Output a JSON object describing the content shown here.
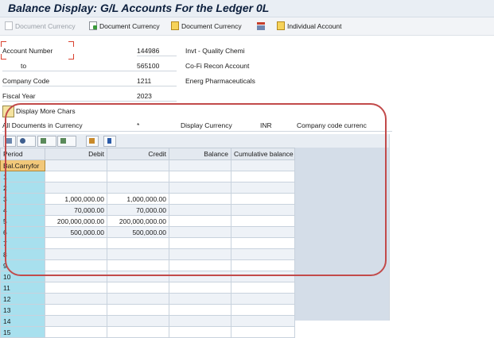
{
  "window": {
    "title": "Balance Display: G/L Accounts For the Ledger 0L"
  },
  "toolbar": {
    "buttons": [
      {
        "label": "Document Currency",
        "icon": "doc-gray-icon",
        "enabled": false
      },
      {
        "label": "Document Currency",
        "icon": "doc-green-icon",
        "enabled": true
      },
      {
        "label": "Document Currency",
        "icon": "doc-yellow-icon",
        "enabled": true
      },
      {
        "label": "",
        "icon": "grid-icon",
        "enabled": true
      },
      {
        "label": "Individual Account",
        "icon": "doc-yellow-icon",
        "enabled": true
      }
    ]
  },
  "header": {
    "account_number": {
      "label": "Account Number",
      "value": "144986",
      "desc": "Invt - Quality Chemi"
    },
    "to": {
      "label": "to",
      "value": "565100",
      "desc": "Co-Fi Recon Account"
    },
    "company_code": {
      "label": "Company Code",
      "value": "1211",
      "desc": "Energ Pharmaceuticals"
    },
    "fiscal_year": {
      "label": "Fiscal Year",
      "value": "2023"
    }
  },
  "more_chars": {
    "label": "Display More Chars"
  },
  "filter": {
    "all_docs_label": "All Documents in Currency",
    "all_docs_value": "*",
    "display_currency_label": "Display Currency",
    "display_currency_value": "INR",
    "company_code_currency": "Company code currenc"
  },
  "grid": {
    "columns": [
      "Period",
      "Debit",
      "Credit",
      "Balance",
      "Cumulative balance"
    ],
    "rows": [
      {
        "period": "Bal.Carryfor",
        "debit": "",
        "credit": "",
        "balance": "",
        "cumulative": ""
      },
      {
        "period": "1",
        "debit": "",
        "credit": "",
        "balance": "",
        "cumulative": ""
      },
      {
        "period": "2",
        "debit": "",
        "credit": "",
        "balance": "",
        "cumulative": ""
      },
      {
        "period": "3",
        "debit": "1,000,000.00",
        "credit": "1,000,000.00",
        "balance": "",
        "cumulative": ""
      },
      {
        "period": "4",
        "debit": "70,000.00",
        "credit": "70,000.00",
        "balance": "",
        "cumulative": ""
      },
      {
        "period": "5",
        "debit": "200,000,000.00",
        "credit": "200,000,000.00",
        "balance": "",
        "cumulative": ""
      },
      {
        "period": "6",
        "debit": "500,000.00",
        "credit": "500,000.00",
        "balance": "",
        "cumulative": ""
      },
      {
        "period": "7",
        "debit": "",
        "credit": "",
        "balance": "",
        "cumulative": ""
      },
      {
        "period": "8",
        "debit": "",
        "credit": "",
        "balance": "",
        "cumulative": ""
      },
      {
        "period": "9",
        "debit": "",
        "credit": "",
        "balance": "",
        "cumulative": ""
      },
      {
        "period": "10",
        "debit": "",
        "credit": "",
        "balance": "",
        "cumulative": ""
      },
      {
        "period": "11",
        "debit": "",
        "credit": "",
        "balance": "",
        "cumulative": ""
      },
      {
        "period": "12",
        "debit": "",
        "credit": "",
        "balance": "",
        "cumulative": ""
      },
      {
        "period": "13",
        "debit": "",
        "credit": "",
        "balance": "",
        "cumulative": ""
      },
      {
        "period": "14",
        "debit": "",
        "credit": "",
        "balance": "",
        "cumulative": ""
      },
      {
        "period": "15",
        "debit": "",
        "credit": "",
        "balance": "",
        "cumulative": ""
      }
    ]
  },
  "colors": {
    "title_text": "#0c1f3d",
    "period_cell": "#a8e0ee",
    "selected_cell": "#f2c87a",
    "annotation_oval": "#c24a4a"
  }
}
